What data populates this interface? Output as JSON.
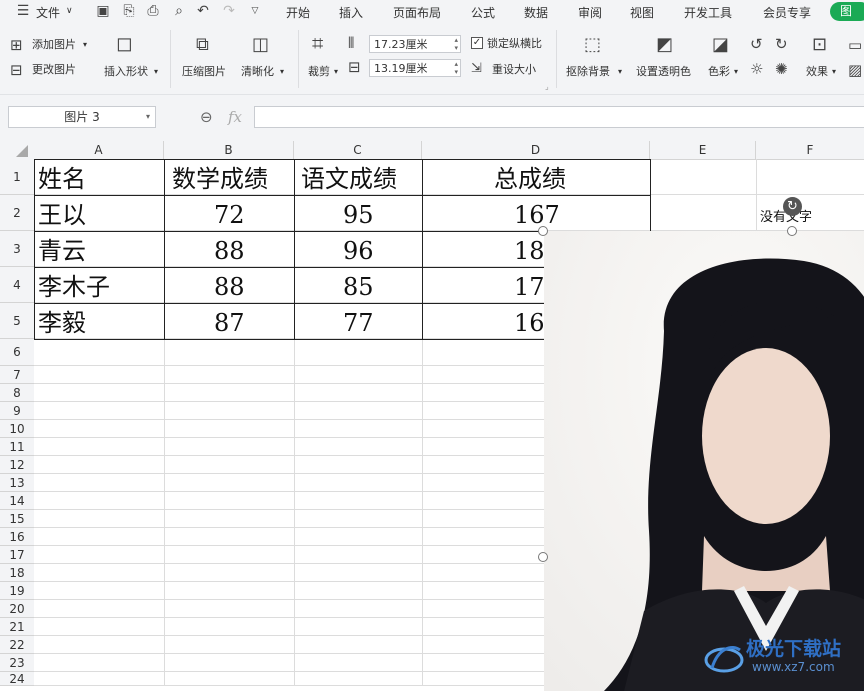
{
  "menubar": {
    "file_label": "文件",
    "tabs": [
      "开始",
      "插入",
      "页面布局",
      "公式",
      "数据",
      "审阅",
      "视图",
      "开发工具",
      "会员专享"
    ],
    "right_tab": "图"
  },
  "toolbar": {
    "add_image": "添加图片",
    "change_image": "更改图片",
    "insert_shape": "插入形状",
    "compress_image": "压缩图片",
    "sharpen": "清晰化",
    "crop": "裁剪",
    "width_value": "17.23厘米",
    "height_value": "13.19厘米",
    "lock_ratio": "锁定纵横比",
    "reset_size": "重设大小",
    "remove_bg": "抠除背景",
    "set_transparent": "设置透明色",
    "color": "色彩",
    "effects": "效果"
  },
  "formula": {
    "namebox": "图片 3",
    "fx": "fx"
  },
  "columns": [
    "A",
    "B",
    "C",
    "D",
    "E",
    "F"
  ],
  "rows": [
    "1",
    "2",
    "3",
    "4",
    "5",
    "6",
    "7",
    "8",
    "9",
    "10",
    "11",
    "12",
    "13",
    "14",
    "15",
    "16",
    "17",
    "18",
    "19",
    "20",
    "21",
    "22",
    "23",
    "24"
  ],
  "table": {
    "headers": [
      "姓名",
      "数学成绩",
      "语文成绩",
      "总成绩"
    ],
    "data": [
      [
        "王以",
        "72",
        "95",
        "167"
      ],
      [
        "青云",
        "88",
        "96",
        "18"
      ],
      [
        "李木子",
        "88",
        "85",
        "17"
      ],
      [
        "李毅",
        "87",
        "77",
        "16"
      ]
    ]
  },
  "f2_text": "没有文字",
  "watermark": {
    "brand": "极光下载站",
    "url": "www.xz7.com"
  }
}
